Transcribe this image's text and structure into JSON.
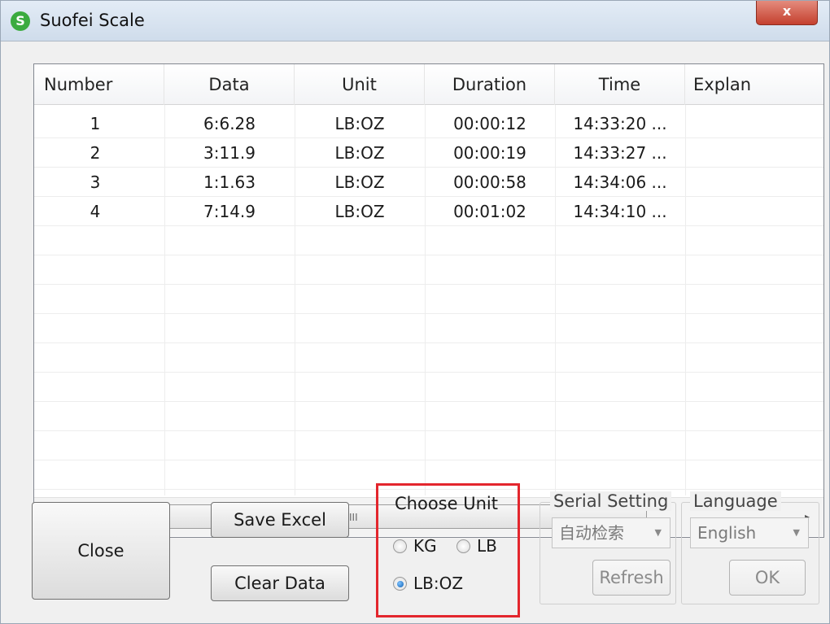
{
  "window": {
    "title": "Suofei Scale",
    "close_glyph": "x"
  },
  "table": {
    "columns": [
      "Number",
      "Data",
      "Unit",
      "Duration",
      "Time",
      "Explan"
    ],
    "rows": [
      [
        "1",
        "6:6.28",
        "LB:OZ",
        "00:00:12",
        "14:33:20 ...",
        ""
      ],
      [
        "2",
        "3:11.9",
        "LB:OZ",
        "00:00:19",
        "14:33:27 ...",
        ""
      ],
      [
        "3",
        "1:1.63",
        "LB:OZ",
        "00:00:58",
        "14:34:06 ...",
        ""
      ],
      [
        "4",
        "7:14.9",
        "LB:OZ",
        "00:01:02",
        "14:34:10 ...",
        ""
      ]
    ],
    "scroll_left": "◂",
    "scroll_right": "▸",
    "scroll_grip": "III"
  },
  "buttons": {
    "close": "Close",
    "save_excel": "Save Excel",
    "clear_data": "Clear Data",
    "refresh": "Refresh",
    "ok": "OK"
  },
  "choose_unit": {
    "title": "Choose Unit",
    "options": [
      "KG",
      "LB",
      "LB:OZ"
    ],
    "selected": "LB:OZ"
  },
  "serial": {
    "title": "Serial Setting",
    "value": "自动检索",
    "arrow": "▼"
  },
  "language": {
    "title": "Language",
    "value": "English",
    "arrow": "▼"
  },
  "colors": {
    "highlight": "#e3262d",
    "app_icon": "#3bab3f"
  },
  "icons": {
    "app_icon": "suofei-app-icon",
    "app_glyph": "S"
  }
}
